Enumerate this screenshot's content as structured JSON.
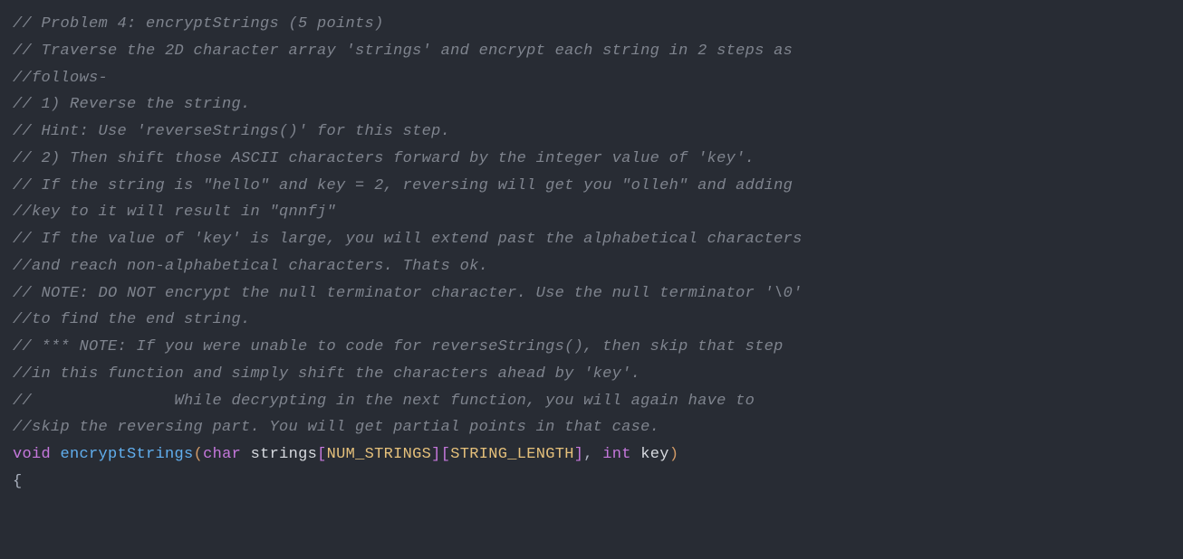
{
  "code": {
    "comments": {
      "l1": "// Problem 4: encryptStrings (5 points)",
      "l2": "// Traverse the 2D character array 'strings' and encrypt each string in 2 steps as",
      "l3": "//follows-",
      "l4": "// 1) Reverse the string.",
      "l5": "// Hint: Use 'reverseStrings()' for this step.",
      "l6": "// 2) Then shift those ASCII characters forward by the integer value of 'key'.",
      "l7": "// If the string is \"hello\" and key = 2, reversing will get you \"olleh\" and adding",
      "l8": "//key to it will result in \"qnnfj\"",
      "l9": "// If the value of 'key' is large, you will extend past the alphabetical characters",
      "l10": "//and reach non-alphabetical characters. Thats ok.",
      "l11": "// NOTE: DO NOT encrypt the null terminator character. Use the null terminator '\\0'",
      "l12": "//to find the end string.",
      "l13": "// *** NOTE: If you were unable to code for reverseStrings(), then skip that step",
      "l14": "//in this function and simply shift the characters ahead by 'key'.",
      "l15": "//               While decrypting in the next function, you will again have to",
      "l16": "//skip the reversing part. You will get partial points in that case."
    },
    "signature": {
      "return_type": "void",
      "function_name": "encryptStrings",
      "param1_type": "char",
      "param1_name": "strings",
      "dim1": "NUM_STRINGS",
      "dim2": "STRING_LENGTH",
      "param2_type": "int",
      "param2_name": "key",
      "open_paren": "(",
      "close_paren": ")",
      "open_bracket1": "[",
      "close_bracket1": "]",
      "open_bracket2": "[",
      "close_bracket2": "]",
      "comma": ", ",
      "space": " "
    },
    "body": {
      "open_brace": "{"
    }
  }
}
